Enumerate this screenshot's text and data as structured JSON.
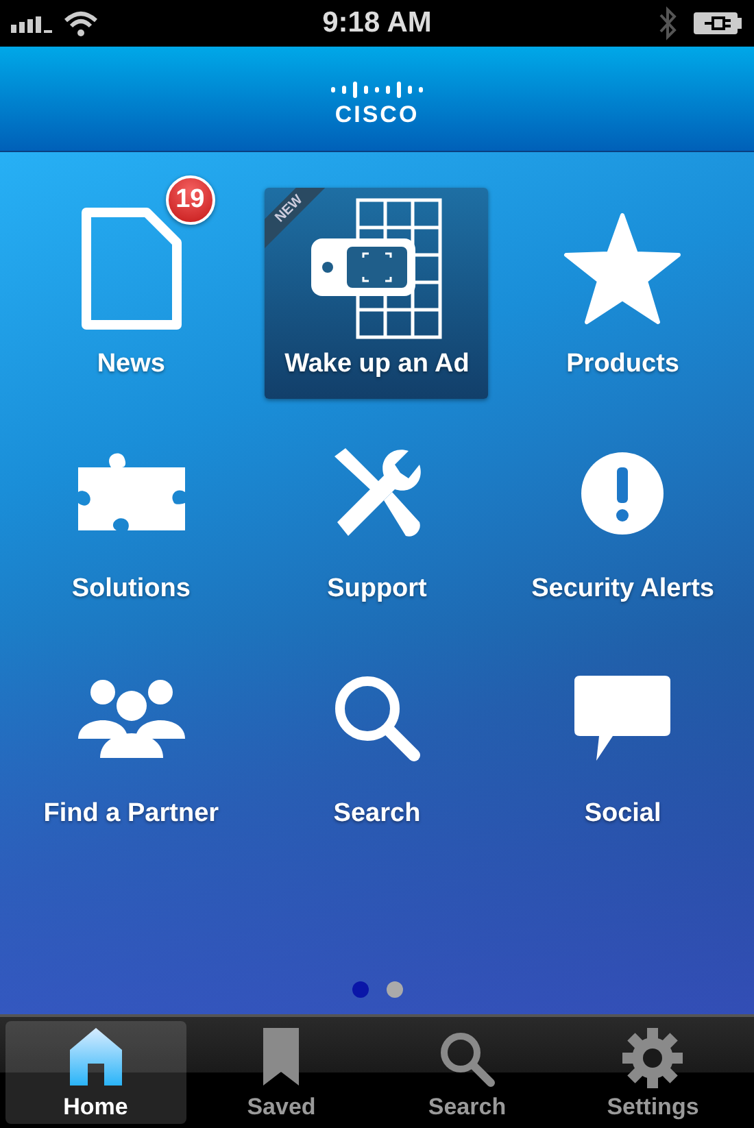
{
  "status_bar": {
    "time": "9:18 AM"
  },
  "header": {
    "logo": "CISCO"
  },
  "tiles": [
    {
      "label": "News",
      "badge": "19",
      "selected": false
    },
    {
      "label": "Wake up an Ad",
      "ribbon": "NEW",
      "selected": true
    },
    {
      "label": "Products",
      "selected": false
    },
    {
      "label": "Solutions",
      "selected": false
    },
    {
      "label": "Support",
      "selected": false
    },
    {
      "label": "Security Alerts",
      "selected": false
    },
    {
      "label": "Find a Partner",
      "selected": false
    },
    {
      "label": "Search",
      "selected": false
    },
    {
      "label": "Social",
      "selected": false
    }
  ],
  "page_dots": [
    {
      "selected": true
    },
    {
      "selected": false
    }
  ],
  "tabs": [
    {
      "label": "Home",
      "selected": true
    },
    {
      "label": "Saved",
      "selected": false
    },
    {
      "label": "Search",
      "selected": false
    },
    {
      "label": "Settings",
      "selected": false
    }
  ]
}
